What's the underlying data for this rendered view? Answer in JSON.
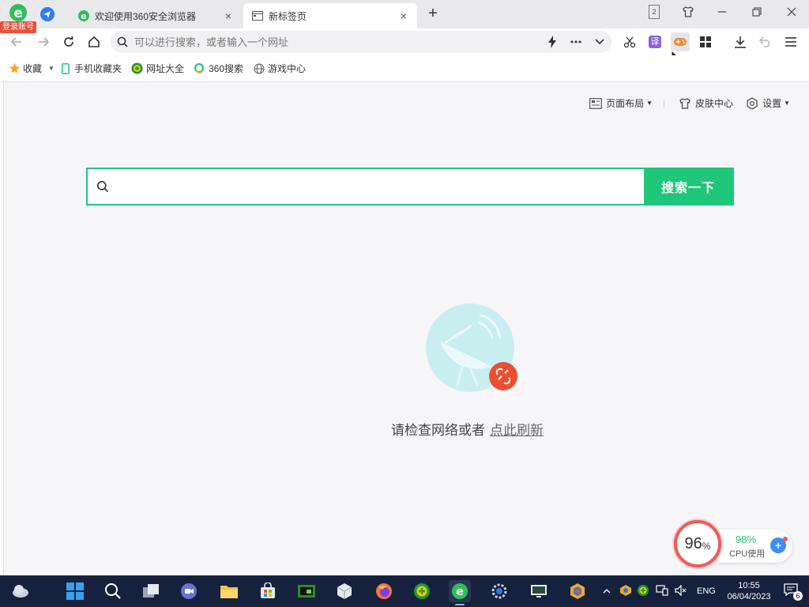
{
  "browser": {
    "login_badge": "登录账号",
    "tabs": [
      {
        "title": "欢迎使用360安全浏览器",
        "close": "×"
      },
      {
        "title": "新标签页",
        "close": "×"
      }
    ],
    "new_tab_label": "+",
    "tab_counter": "2",
    "address_placeholder": "可以进行搜索，或者输入一个网址",
    "translate_label": "译"
  },
  "bookmarks": [
    {
      "label": "收藏",
      "icon": "star-icon"
    },
    {
      "label": "手机收藏夹",
      "icon": "phone-icon"
    },
    {
      "label": "网址大全",
      "icon": "nav-site-icon"
    },
    {
      "label": "360搜索",
      "icon": "search360-icon"
    },
    {
      "label": "游戏中心",
      "icon": "globe-icon"
    }
  ],
  "page": {
    "layout_label": "页面布局",
    "skin_label": "皮肤中心",
    "settings_label": "设置",
    "search_button": "搜索一下",
    "error_message": "请检查网络或者",
    "refresh_link": "点此刷新"
  },
  "cpu_widget": {
    "memory_value": "96",
    "memory_unit": "%",
    "cpu_value": "98%",
    "cpu_label": "CPU使用",
    "plus": "+"
  },
  "taskbar": {
    "language": "ENG",
    "time": "10:55",
    "date": "06/04/2023",
    "notifications": "6"
  },
  "colors": {
    "accent_green": "#1ec77a",
    "badge_red": "#e9513a",
    "taskbar_bg": "#16213d"
  }
}
